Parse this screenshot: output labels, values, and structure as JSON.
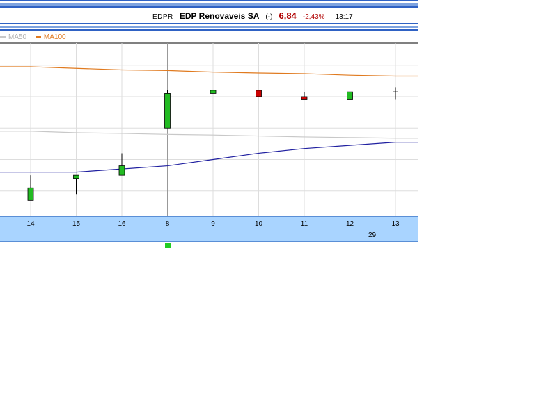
{
  "header": {
    "ticker": "EDPR",
    "name": "EDP Renovaveis SA",
    "change_sign": "(-)",
    "price": "6,84",
    "change_pct": "-2,43%",
    "time": "13:17"
  },
  "legend": {
    "ma50": "MA50",
    "ma100": "MA100"
  },
  "colors": {
    "header_stripe": "#2f62c4",
    "axis_bar": "#a9d4ff",
    "grid": "#dddddd",
    "up": "#22bb22",
    "down": "#cc0000",
    "ma50": "#c8c8c8",
    "ma100": "#e07a1f",
    "extra_ma": "#2020a0",
    "price_text": "#b00000"
  },
  "chart_data": {
    "type": "candlestick",
    "categories": [
      "14",
      "15",
      "16",
      "8",
      "9",
      "10",
      "11",
      "12",
      "13"
    ],
    "month_label": "29",
    "series": [
      {
        "kind": "ohlc",
        "candles": [
          {
            "o": 6.47,
            "h": 6.55,
            "l": 6.47,
            "c": 6.51,
            "dir": "up"
          },
          {
            "o": 6.54,
            "h": 6.55,
            "l": 6.49,
            "c": 6.55,
            "dir": "up"
          },
          {
            "o": 6.55,
            "h": 6.62,
            "l": 6.55,
            "c": 6.58,
            "dir": "up"
          },
          {
            "o": 6.7,
            "h": 6.82,
            "l": 6.7,
            "c": 6.81,
            "dir": "up"
          },
          {
            "o": 6.81,
            "h": 6.822,
            "l": 6.81,
            "c": 6.82,
            "dir": "up"
          },
          {
            "o": 6.8,
            "h": 6.822,
            "l": 6.8,
            "c": 6.82,
            "dir": "down"
          },
          {
            "o": 6.79,
            "h": 6.815,
            "l": 6.79,
            "c": 6.8,
            "dir": "down"
          },
          {
            "o": 6.79,
            "h": 6.825,
            "l": 6.785,
            "c": 6.815,
            "dir": "up"
          },
          {
            "o": 6.815,
            "h": 6.83,
            "l": 6.79,
            "c": 6.815,
            "dir": "flat"
          }
        ]
      },
      {
        "name": "MA50",
        "values": [
          6.69,
          6.685,
          6.683,
          6.68,
          6.678,
          6.675,
          6.672,
          6.67,
          6.668
        ]
      },
      {
        "name": "MA100",
        "values": [
          6.895,
          6.89,
          6.885,
          6.883,
          6.878,
          6.875,
          6.873,
          6.868,
          6.865
        ]
      },
      {
        "values": [
          6.56,
          6.56,
          6.57,
          6.58,
          6.6,
          6.62,
          6.635,
          6.645,
          6.655
        ]
      }
    ],
    "ylim": [
      6.42,
      6.97
    ],
    "grid": true,
    "legend_position": "top-left"
  }
}
